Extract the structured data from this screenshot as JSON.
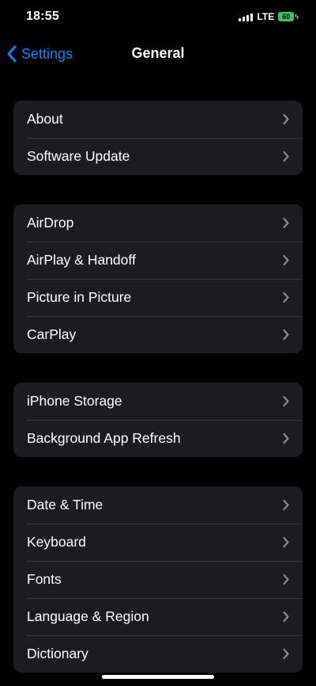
{
  "status_bar": {
    "time": "18:55",
    "network": "LTE",
    "battery_percent": "60",
    "battery_color": "#34c759"
  },
  "nav": {
    "back_label": "Settings",
    "title": "General",
    "accent_color": "#0a84ff"
  },
  "groups": [
    {
      "items": [
        {
          "label": "About"
        },
        {
          "label": "Software Update"
        }
      ]
    },
    {
      "items": [
        {
          "label": "AirDrop"
        },
        {
          "label": "AirPlay & Handoff"
        },
        {
          "label": "Picture in Picture"
        },
        {
          "label": "CarPlay"
        }
      ]
    },
    {
      "items": [
        {
          "label": "iPhone Storage"
        },
        {
          "label": "Background App Refresh"
        }
      ]
    },
    {
      "items": [
        {
          "label": "Date & Time"
        },
        {
          "label": "Keyboard"
        },
        {
          "label": "Fonts"
        },
        {
          "label": "Language & Region"
        },
        {
          "label": "Dictionary"
        }
      ]
    }
  ],
  "icons": {
    "back": "chevron-left-icon",
    "row": "chevron-right-icon",
    "signal": "cellular-signal-icon",
    "battery": "battery-charging-icon"
  }
}
